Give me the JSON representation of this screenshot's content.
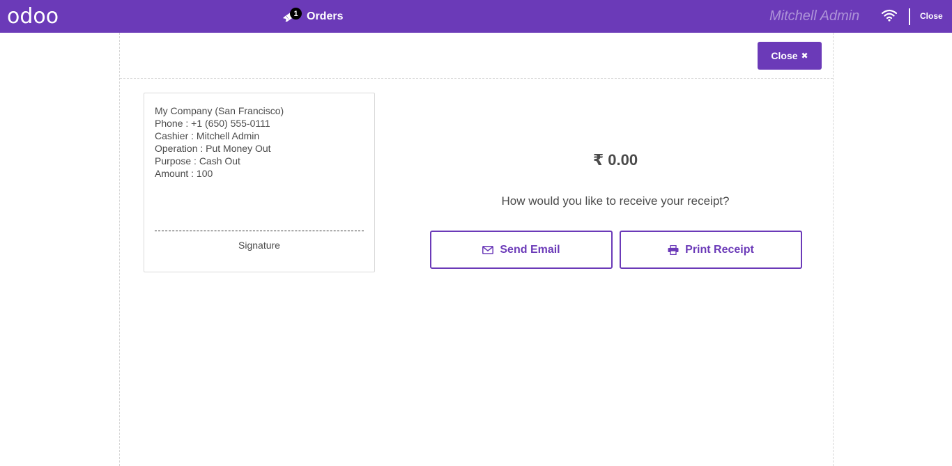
{
  "topbar": {
    "logo": "odoo",
    "orders_label": "Orders",
    "orders_count": "1",
    "cashier_name": "Mitchell Admin",
    "close_label": "Close",
    "accent_color": "#6b3ab8"
  },
  "screen": {
    "close_button_label": "Close",
    "close_icon": "✖"
  },
  "receipt": {
    "lines": [
      "My Company (San Francisco)",
      "Phone : +1 (650) 555-0111",
      "Cashier : Mitchell Admin",
      "Operation : Put Money Out",
      "Purpose : Cash Out",
      "Amount : 100"
    ],
    "signature_label": "Signature"
  },
  "summary": {
    "amount": "₹ 0.00",
    "question": "How would you like to receive your receipt?",
    "send_email_label": "Send Email",
    "print_receipt_label": "Print Receipt"
  },
  "icons": {
    "orders": "ticket-icon",
    "wifi": "wifi-icon",
    "email": "envelope-icon",
    "print": "printer-icon"
  }
}
